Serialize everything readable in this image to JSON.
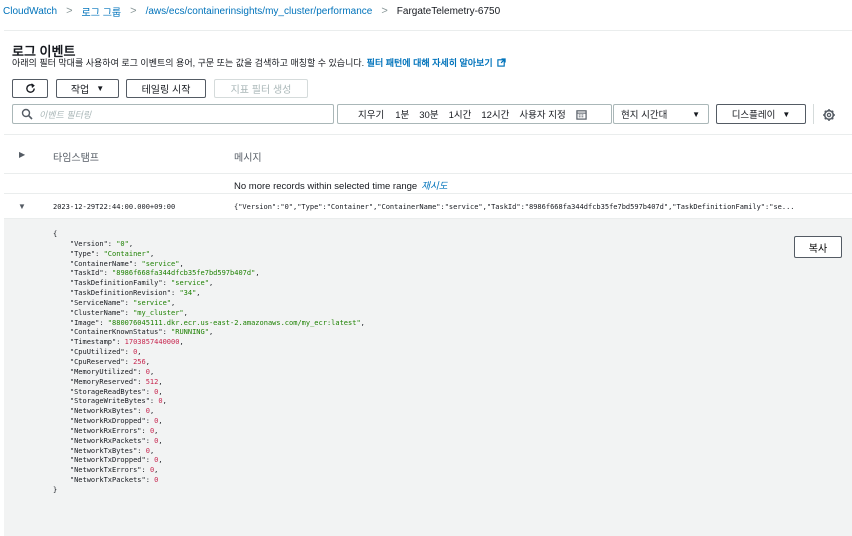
{
  "breadcrumb": {
    "items": [
      "CloudWatch",
      "로그 그룹",
      "/aws/ecs/containerinsights/my_cluster/performance",
      "FargateTelemetry-6750"
    ],
    "separator": ">"
  },
  "header": {
    "title": "로그 이벤트",
    "description": "아래의 필터 막대를 사용하여 로그 이벤트의 용어, 구문 또는 값을 검색하고 매칭할 수 있습니다.",
    "learn_more": "필터 패턴에 대해 자세히 알아보기"
  },
  "toolbar": {
    "refresh_icon": "refresh-icon",
    "action_label": "작업",
    "tail_label": "테일링 시작",
    "metric_filter_label": "지표 필터 생성"
  },
  "filter": {
    "placeholder": "이벤트 필터링",
    "clear_label": "지우기",
    "ranges": [
      "1분",
      "30분",
      "1시간",
      "12시간",
      "사용자 지정"
    ],
    "calendar_icon": "calendar-icon",
    "timezone_value": "현지 시간대",
    "display_label": "디스플레이",
    "settings_icon": "gear-icon"
  },
  "table": {
    "headers": {
      "timestamp": "타임스탬프",
      "message": "메시지"
    },
    "no_more": "No more records within selected time range",
    "retry": "재시도",
    "row": {
      "timestamp": "2023-12-29T22:44:00.000+09:00",
      "message": "{\"Version\":\"0\",\"Type\":\"Container\",\"ContainerName\":\"service\",\"TaskId\":\"8986f668fa344dfcb35fe7bd597b407d\",\"TaskDefinitionFamily\":\"se..."
    },
    "copy_label": "복사",
    "json_lines": [
      {
        "key": "\"Version\"",
        "val": "\"0\"",
        "type": "s"
      },
      {
        "key": "\"Type\"",
        "val": "\"Container\"",
        "type": "s"
      },
      {
        "key": "\"ContainerName\"",
        "val": "\"service\"",
        "type": "s"
      },
      {
        "key": "\"TaskId\"",
        "val": "\"8986f668fa344dfcb35fe7bd597b407d\"",
        "type": "s"
      },
      {
        "key": "\"TaskDefinitionFamily\"",
        "val": "\"service\"",
        "type": "s"
      },
      {
        "key": "\"TaskDefinitionRevision\"",
        "val": "\"34\"",
        "type": "s"
      },
      {
        "key": "\"ServiceName\"",
        "val": "\"service\"",
        "type": "s"
      },
      {
        "key": "\"ClusterName\"",
        "val": "\"my_cluster\"",
        "type": "s"
      },
      {
        "key": "\"Image\"",
        "val": "\"880076045111.dkr.ecr.us-east-2.amazonaws.com/my_ecr:latest\"",
        "type": "s"
      },
      {
        "key": "\"ContainerKnownStatus\"",
        "val": "\"RUNNING\"",
        "type": "s"
      },
      {
        "key": "\"Timestamp\"",
        "val": "1703857440000",
        "type": "n"
      },
      {
        "key": "\"CpuUtilized\"",
        "val": "0",
        "type": "n"
      },
      {
        "key": "\"CpuReserved\"",
        "val": "256",
        "type": "n"
      },
      {
        "key": "\"MemoryUtilized\"",
        "val": "0",
        "type": "n"
      },
      {
        "key": "\"MemoryReserved\"",
        "val": "512",
        "type": "n"
      },
      {
        "key": "\"StorageReadBytes\"",
        "val": "0",
        "type": "n"
      },
      {
        "key": "\"StorageWriteBytes\"",
        "val": "0",
        "type": "n"
      },
      {
        "key": "\"NetworkRxBytes\"",
        "val": "0",
        "type": "n"
      },
      {
        "key": "\"NetworkRxDropped\"",
        "val": "0",
        "type": "n"
      },
      {
        "key": "\"NetworkRxErrors\"",
        "val": "0",
        "type": "n"
      },
      {
        "key": "\"NetworkRxPackets\"",
        "val": "0",
        "type": "n"
      },
      {
        "key": "\"NetworkTxBytes\"",
        "val": "0",
        "type": "n"
      },
      {
        "key": "\"NetworkTxDropped\"",
        "val": "0",
        "type": "n"
      },
      {
        "key": "\"NetworkTxErrors\"",
        "val": "0",
        "type": "n"
      },
      {
        "key": "\"NetworkTxPackets\"",
        "val": "0",
        "type": "n"
      }
    ]
  }
}
